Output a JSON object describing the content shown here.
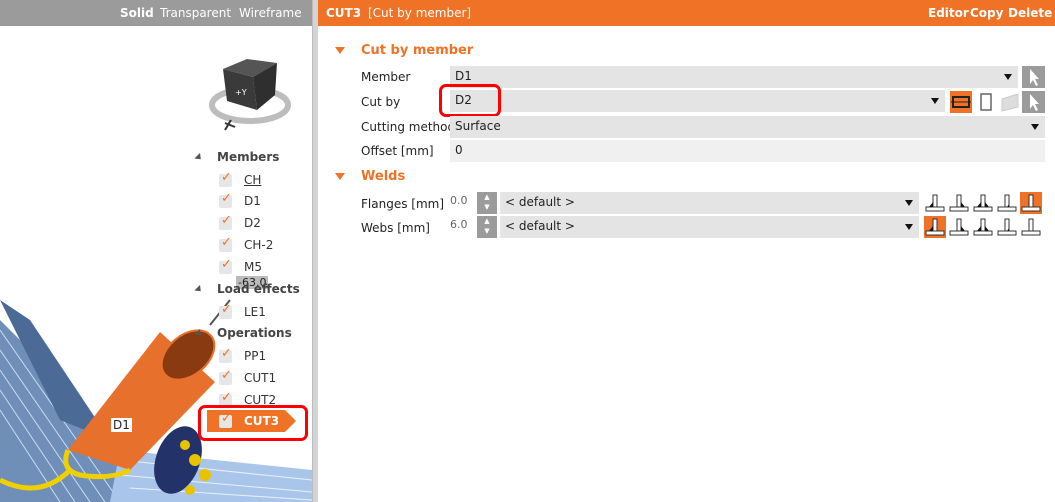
{
  "view_modes": [
    "Solid",
    "Transparent",
    "Wireframe"
  ],
  "tree": {
    "groups": [
      {
        "label": "Members",
        "items": [
          "CH",
          "D1",
          "D2",
          "CH-2",
          "M5"
        ]
      },
      {
        "label": "Load effects",
        "items": [
          "LE1"
        ]
      },
      {
        "label": "Operations",
        "items": [
          "PP1",
          "CUT1",
          "CUT2",
          "CUT3"
        ]
      }
    ],
    "selected": "CUT3"
  },
  "scene": {
    "dimension_label": "-63.0",
    "member_label": "D1"
  },
  "header": {
    "name": "CUT3",
    "type": "[Cut by member]",
    "actions": [
      "Editor",
      "Copy",
      "Delete"
    ]
  },
  "cut_section": {
    "title": "Cut by member",
    "member_label": "Member",
    "member_value": "D1",
    "cutby_label": "Cut by",
    "cutby_value": "D2",
    "method_label": "Cutting method",
    "method_value": "Surface",
    "offset_label": "Offset [mm]",
    "offset_value": "0"
  },
  "welds_section": {
    "title": "Welds",
    "flanges_label": "Flanges [mm]",
    "flanges_value": "0.0",
    "flanges_type": "< default >",
    "webs_label": "Webs [mm]",
    "webs_value": "6.0",
    "webs_type": "< default >"
  },
  "colors": {
    "accent": "#f07226",
    "header_grey": "#9b9b9b",
    "highlight": "#ff0000"
  }
}
